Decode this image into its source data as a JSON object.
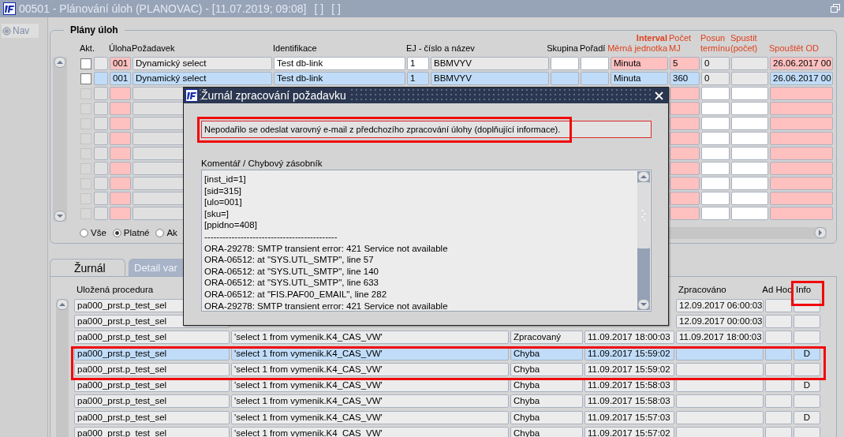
{
  "window": {
    "title": "00501 - Plánování úloh (PLANOVAC) - [11.07.2019; 09:08]",
    "markers": [
      "[ ]",
      "[ ]"
    ]
  },
  "nav": {
    "label": "Nav",
    "selected": true
  },
  "plans": {
    "title": "Plány úloh",
    "group_header": "Interval",
    "headers": {
      "active": {
        "label": "Akt.",
        "required": false
      },
      "task": {
        "label": "Úloha",
        "required": false
      },
      "request": {
        "label": "Požadavek",
        "required": false
      },
      "ident": {
        "label": "Identifikace",
        "required": false
      },
      "ej": {
        "label": "EJ - číslo a název",
        "required": false
      },
      "group": {
        "label": "Skupina",
        "required": false
      },
      "order": {
        "label": "Pořadí",
        "required": false
      },
      "unit": {
        "label": "Měrná jednotka",
        "required": true
      },
      "count": {
        "label_top": "Počet",
        "label": "MJ",
        "required": true
      },
      "shift": {
        "label_top": "Posun",
        "label": "termínu",
        "required": true
      },
      "runs": {
        "label_top": "Spustit",
        "label": "(počet)",
        "required": true
      },
      "start_from": {
        "label": "Spouštět OD",
        "required": true
      }
    },
    "rows": [
      {
        "kind": "record",
        "checked": false,
        "disabled": false,
        "selected": false,
        "task": "001",
        "request": "Dynamický select",
        "ident": "Test db-link",
        "ej_no": "1",
        "ej_name": "BBMVYV",
        "unit": "Minuta",
        "count": "5",
        "shift": "0",
        "start_from": "26.06.2017 00"
      },
      {
        "kind": "record",
        "checked": false,
        "disabled": false,
        "selected": true,
        "task": "001",
        "request": "Dynamický select",
        "ident": "Test db-link",
        "ej_no": "1",
        "ej_name": "BBMVYV",
        "unit": "Minuta",
        "count": "360",
        "shift": "0",
        "start_from": "26.06.2017 00"
      },
      {
        "kind": "blank",
        "disabled": true
      },
      {
        "kind": "blank",
        "disabled": true
      },
      {
        "kind": "blank",
        "disabled": true
      },
      {
        "kind": "blank",
        "disabled": true
      },
      {
        "kind": "blank",
        "disabled": true
      },
      {
        "kind": "blank",
        "disabled": true
      },
      {
        "kind": "blank",
        "disabled": true
      },
      {
        "kind": "blank",
        "disabled": true
      },
      {
        "kind": "blank",
        "disabled": true
      }
    ],
    "filters": [
      {
        "label": "Vše",
        "selected": false
      },
      {
        "label": "Platné",
        "selected": true
      },
      {
        "label": "Ak",
        "selected": false
      }
    ]
  },
  "journal": {
    "tabs": [
      {
        "label": "Žurnál",
        "selected": true
      },
      {
        "label": "Detail var",
        "selected": false
      }
    ],
    "headers": {
      "procedure": "Uložená procedura",
      "processed": "Zpracováno",
      "ad_hoc": "Ad Hoc",
      "info": "Info"
    },
    "rows": [
      {
        "selected": false,
        "procedure": "pa000_prst.p_test_sel",
        "processed": "12.09.2017 06:00:03"
      },
      {
        "selected": false,
        "procedure": "pa000_prst.p_test_sel",
        "processed": "12.09.2017 00:00:03"
      },
      {
        "selected": false,
        "procedure": "pa000_prst.p_test_sel",
        "column_2": "'select 1 from vymenik.K4_CAS_VW'",
        "column_3": "Zpracovaný",
        "column_4": "11.09.2017 18:00:03",
        "processed": "11.09.2017 18:00:03"
      },
      {
        "selected": true,
        "procedure": "pa000_prst.p_test_sel",
        "column_2": "'select 1 from vymenik.K4_CAS_VW'",
        "column_3": "Chyba",
        "column_4": "11.09.2017 15:59:02",
        "info": "D"
      },
      {
        "selected": false,
        "procedure": "pa000_prst.p_test_sel",
        "column_2": "'select 1 from vymenik.K4_CAS_VW'",
        "column_3": "Chyba",
        "column_4": "11.09.2017 15:59:02"
      },
      {
        "selected": false,
        "procedure": "pa000_prst.p_test_sel",
        "column_2": "'select 1 from vymenik.K4_CAS_VW'",
        "column_3": "Chyba",
        "column_4": "11.09.2017 15:58:03",
        "info": "D"
      },
      {
        "selected": false,
        "procedure": "pa000_prst.p_test_sel",
        "column_2": "'select 1 from vymenik.K4_CAS_VW'",
        "column_3": "Chyba",
        "column_4": "11.09.2017 15:58:03"
      },
      {
        "selected": false,
        "procedure": "pa000_prst.p_test_sel",
        "column_2": "'select 1 from vymenik.K4_CAS_VW'",
        "column_3": "Chyba",
        "column_4": "11.09.2017 15:57:03",
        "info": "D"
      },
      {
        "selected": false,
        "procedure": "pa000_prst.p_test_sel",
        "column_2": "'select 1 from vymenik.K4_CAS_VW'",
        "column_3": "Chyba",
        "column_4": "11.09.2017 15:57:02"
      }
    ]
  },
  "dialog": {
    "title": "Žurnál zpracování požadavku",
    "message": "Nepodařilo se odeslat varovný e-mail z předchozího zpracování úlohy (doplňující informace).",
    "log_label": "Komentář / Chybový zásobník",
    "log_lines": [
      "[inst_id=1]",
      "[sid=315]",
      "[ulo=001]",
      "[sku=]",
      "[ppidno=408]",
      "--------------------------------------------",
      "ORA-29278: SMTP transient error: 421 Service not available",
      "ORA-06512: at \"SYS.UTL_SMTP\", line 57",
      "ORA-06512: at \"SYS.UTL_SMTP\", line 140",
      "ORA-06512: at \"SYS.UTL_SMTP\", line 633",
      "ORA-06512: at \"FIS.PAF00_EMAIL\", line 282",
      "ORA-29278: SMTP transient error: 421 Service not available"
    ]
  }
}
